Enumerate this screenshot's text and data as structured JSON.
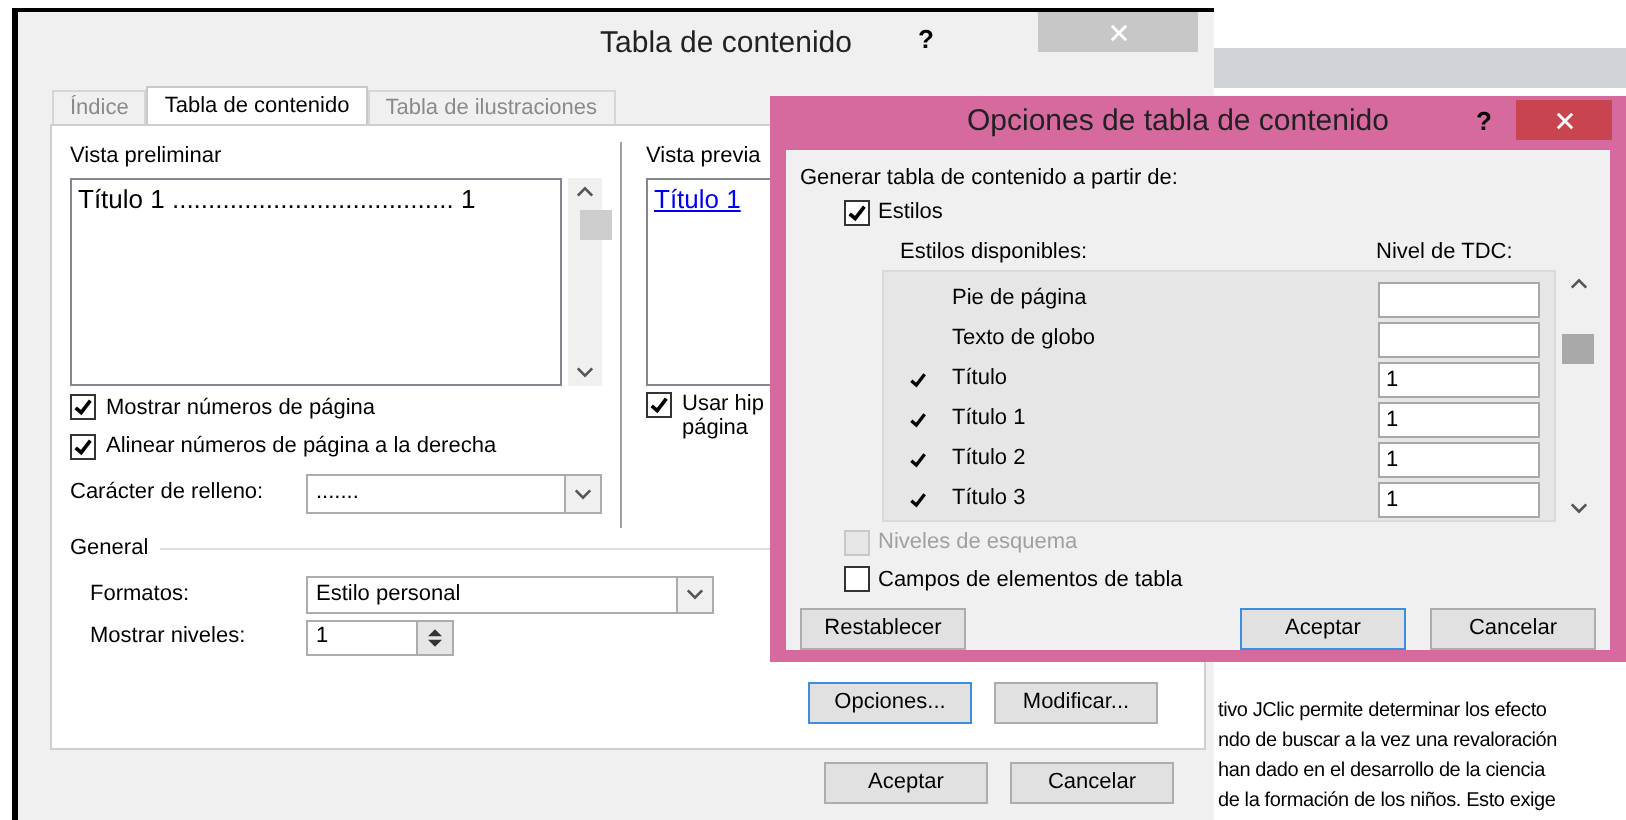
{
  "main_dialog": {
    "title": "Tabla de contenido",
    "help": "?",
    "tabs": [
      {
        "label": "Índice",
        "selected": false
      },
      {
        "label": "Tabla de contenido",
        "selected": true
      },
      {
        "label": "Tabla de ilustraciones",
        "selected": false
      }
    ],
    "print_preview": {
      "label": "Vista preliminar",
      "entry": "Título 1 ....................................... 1"
    },
    "options": [
      {
        "label": "Mostrar números de página",
        "checked": true
      },
      {
        "label": "Alinear números de página a la derecha",
        "checked": true
      }
    ],
    "fill_character": {
      "label": "Carácter de relleno:",
      "value": "......."
    },
    "web_preview": {
      "label": "Vista previa",
      "entry": "Título 1",
      "option": {
        "label_1": "Usar hip",
        "label_2": "página",
        "checked": true
      }
    },
    "general": {
      "label": "General",
      "formats": {
        "label": "Formatos:",
        "value": "Estilo personal"
      },
      "levels": {
        "label": "Mostrar niveles:",
        "value": "1"
      }
    },
    "panel_buttons": [
      "Opciones...",
      "Modificar..."
    ],
    "buttons": [
      "Aceptar",
      "Cancelar"
    ]
  },
  "document_text": [
    "tivo JClic permite determinar los efecto",
    "ndo de buscar a la vez una revaloración",
    "han dado en el desarrollo de la ciencia",
    "de la formación de los niños. Esto exige"
  ],
  "options_dialog": {
    "title": "Opciones de tabla de contenido",
    "help": "?",
    "intro": "Generar tabla de contenido a partir de:",
    "styles": {
      "label": "Estilos",
      "checked": true
    },
    "columns": [
      "Estilos disponibles:",
      "Nivel de TDC:"
    ],
    "rows": [
      {
        "name": "Pie de página",
        "in_use": false,
        "level": ""
      },
      {
        "name": "Texto de globo",
        "in_use": false,
        "level": ""
      },
      {
        "name": "Título",
        "in_use": true,
        "level": "1"
      },
      {
        "name": "Título 1",
        "in_use": true,
        "level": "1"
      },
      {
        "name": "Título 2",
        "in_use": true,
        "level": "1"
      },
      {
        "name": "Título 3",
        "in_use": true,
        "level": "1"
      }
    ],
    "outline_levels": {
      "label": "Niveles de esquema",
      "checked": false,
      "disabled": true
    },
    "table_fields": {
      "label": "Campos de elementos de tabla",
      "checked": false,
      "disabled": false
    },
    "reset": "Restablecer",
    "buttons": [
      "Aceptar",
      "Cancelar"
    ]
  }
}
